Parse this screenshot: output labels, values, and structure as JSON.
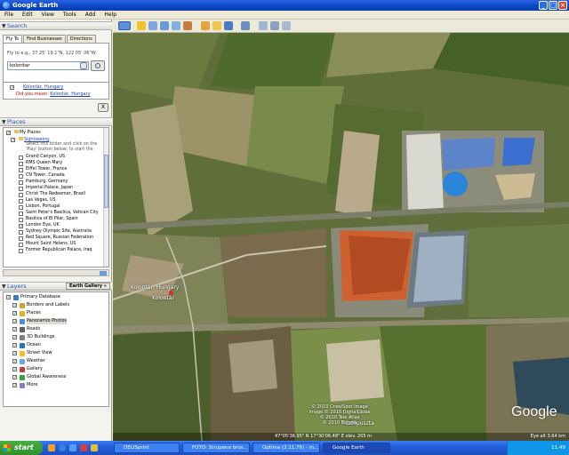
{
  "window": {
    "title": "Google Earth"
  },
  "menu": [
    "File",
    "Edit",
    "View",
    "Tools",
    "Add",
    "Help"
  ],
  "search": {
    "header": "Search",
    "tabs": [
      "Fly To",
      "Find Businesses",
      "Directions"
    ],
    "fly_to_label": "Fly to e.g., 37 25' 19.1\"N, 122 05' 06\"W",
    "query": "kolontar",
    "result_link": "Kolontár, Hungary",
    "did_you_mean_label": "Did you mean:",
    "did_you_mean_link": "Kolontár, Hungary",
    "close_label": "X"
  },
  "places": {
    "header": "Places",
    "my_places": "My Places",
    "folder": "Sightseeing",
    "folder_desc": [
      "Select this folder and click on the",
      "'Play' button below, to start the"
    ],
    "items": [
      {
        "label": "Grand Canyon, US",
        "checked": false
      },
      {
        "label": "RMS Queen Mary",
        "checked": false
      },
      {
        "label": "Eiffel Tower, France",
        "checked": false
      },
      {
        "label": "CN Tower, Canada",
        "checked": false
      },
      {
        "label": "Hamburg, Germany",
        "checked": false
      },
      {
        "label": "Imperial Palace, Japan",
        "checked": false
      },
      {
        "label": "Christ The Redeemer, Brazil",
        "checked": false
      },
      {
        "label": "Las Vegas, US",
        "checked": false
      },
      {
        "label": "Lisbon, Portugal",
        "checked": false
      },
      {
        "label": "Saint Peter's Basilica, Vatican City",
        "checked": false
      },
      {
        "label": "Basilica of El Pilar, Spain",
        "checked": false
      },
      {
        "label": "London Eye, UK",
        "checked": true
      },
      {
        "label": "Sydney Olympic Site, Australia",
        "checked": false
      },
      {
        "label": "Red Square, Russian Federation",
        "checked": false
      },
      {
        "label": "Mount Saint Helens, US",
        "checked": false
      },
      {
        "label": "Former Republican Palace, Iraq",
        "checked": false
      }
    ]
  },
  "layers": {
    "header": "Layers",
    "gallery_button": "Earth Gallery »",
    "items": [
      {
        "label": "Primary Database",
        "icon_color": "#3a78c8"
      },
      {
        "label": "Borders and Labels",
        "icon_color": "#d8a030"
      },
      {
        "label": "Places",
        "icon_color": "#e0b030"
      },
      {
        "label": "Panoramio Photos",
        "icon_color": "#4a90d8"
      },
      {
        "label": "Roads",
        "icon_color": "#606060"
      },
      {
        "label": "3D Buildings",
        "icon_color": "#808080"
      },
      {
        "label": "Ocean",
        "icon_color": "#2a70c0"
      },
      {
        "label": "Street View",
        "icon_color": "#f0c020"
      },
      {
        "label": "Weather",
        "icon_color": "#6aa8e8"
      },
      {
        "label": "Gallery",
        "icon_color": "#c04040"
      },
      {
        "label": "Global Awareness",
        "icon_color": "#40a040"
      },
      {
        "label": "More",
        "icon_color": "#8080c0"
      }
    ]
  },
  "map": {
    "label_town": "Kolontár",
    "label_town_full": "Kolontár, Hungary",
    "label_other": "Ajkarendek",
    "label_other2": "Fűzfőpuszta",
    "credits": [
      "© 2010 Cnes/Spot Image",
      "Image © 2010 DigitalGlobe",
      "© 2010 Tele Atlas",
      "© 2010 Europa"
    ],
    "logo": "Google",
    "status_coords": "47°05'36.95\" N     17°30'06.48\" E     elev.  205 m",
    "eye_alt": "Eye alt   3.64 km"
  },
  "taskbar": {
    "start": "start",
    "tasks": [
      "DELISprint",
      "FOTO: Strupena bros...",
      "Optima (2.11.76) - m...",
      "Google Earth"
    ],
    "clock": "11:49"
  }
}
